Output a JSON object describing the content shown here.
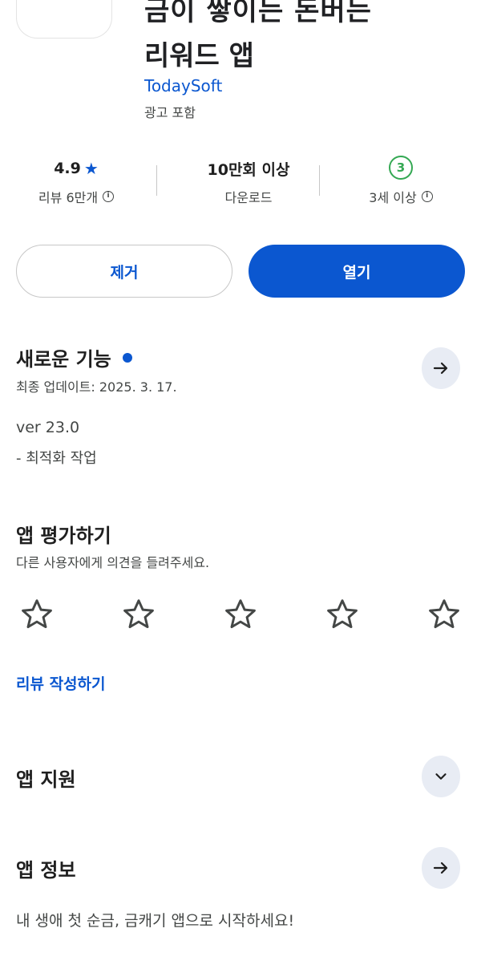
{
  "header": {
    "title_line1": "금이 쌓이는 돈버는",
    "title_line2": "리워드 앱",
    "developer": "TodaySoft",
    "ads_label": "광고 포함"
  },
  "stats": {
    "rating_value": "4.9",
    "rating_label": "리뷰 6만개",
    "downloads_value": "10만회 이상",
    "downloads_label": "다운로드",
    "age_badge": "3",
    "age_label": "3세 이상"
  },
  "actions": {
    "uninstall_label": "제거",
    "open_label": "열기"
  },
  "whats_new": {
    "title": "새로운 기능",
    "last_updated": "최종 업데이트: 2025. 3. 17.",
    "version": "ver 23.0",
    "note": "- 최적화 작업"
  },
  "rate_app": {
    "title": "앱 평가하기",
    "subtitle": "다른 사용자에게 의견을 들려주세요.",
    "star_count": 5,
    "write_review_label": "리뷰 작성하기"
  },
  "app_support": {
    "title": "앱 지원"
  },
  "about_app": {
    "title": "앱 정보",
    "description": "내 생애 첫 순금, 금캐기 앱으로 시작하세요!"
  },
  "colors": {
    "accent": "#0b57d0",
    "age_green": "#34a853",
    "round_button_bg": "#e8ecf4"
  },
  "icons": [
    "star-icon",
    "info-icon",
    "arrow-right-icon",
    "chevron-down-icon",
    "star-outline-icon"
  ]
}
